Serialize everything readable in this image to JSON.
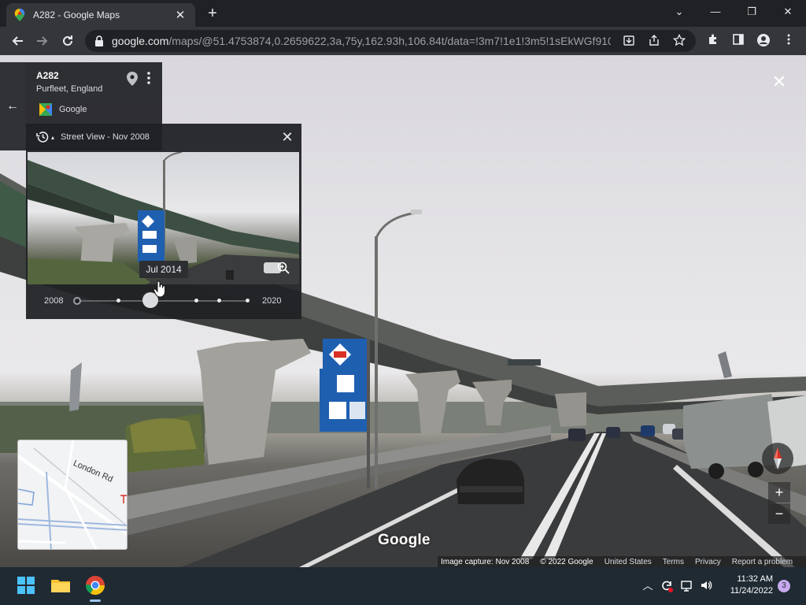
{
  "browser": {
    "tab_title": "A282 - Google Maps",
    "tab_close": "✕",
    "new_tab": "+",
    "url_domain": "google.com",
    "url_path": "/maps/@51.4753874,0.2659622,3a,75y,162.93h,106.84t/data=!3m7!1e1!3m5!1sEkWGf910f...",
    "window": {
      "minimize": "—",
      "restore": "❐",
      "close": "✕",
      "tab_search": "⌄"
    }
  },
  "place": {
    "name": "A282",
    "location": "Purfleet, England",
    "source": "Google",
    "back": "←",
    "more": "⋮"
  },
  "time_machine": {
    "header_label": "Street View - Nov 2008",
    "caret": "▴",
    "close": "✕",
    "tooltip": "Jul 2014",
    "year_start": "2008",
    "year_end": "2020",
    "selected_fraction": 0.42
  },
  "viewer": {
    "close": "✕",
    "minimap_road": "London Rd",
    "zoom_in": "+",
    "zoom_out": "−",
    "logo": "Google"
  },
  "footer": {
    "capture": "Image capture: Nov 2008",
    "copyright": "© 2022 Google",
    "region": "United States",
    "terms": "Terms",
    "privacy": "Privacy",
    "report": "Report a problem"
  },
  "taskbar": {
    "time": "11:32 AM",
    "date": "11/24/2022",
    "notifications": "3",
    "tray_chevron": "︿",
    "volume": "🔊"
  },
  "colors": {
    "chrome_dark": "#202124",
    "chrome_toolbar": "#35363a",
    "taskbar": "#1f2a33",
    "sign_blue": "#1f5fb0",
    "compass_red": "#d93025"
  }
}
